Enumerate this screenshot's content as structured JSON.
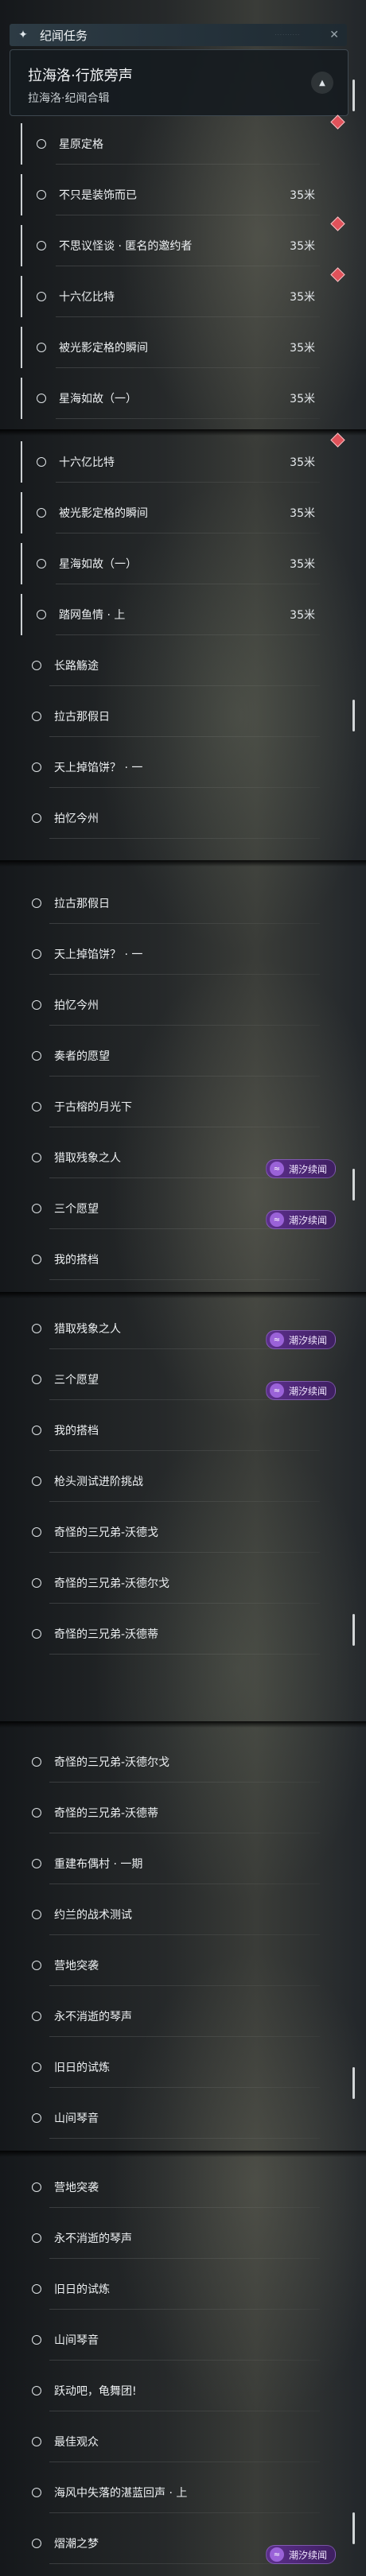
{
  "header": {
    "tab_title": "纪闻任务",
    "mission_title": "拉海洛·行旅旁声",
    "mission_subtitle": "拉海洛·纪闻合辑",
    "tiny_hint": "· · · · · · · · · ·"
  },
  "tag_label": "潮汐续闻",
  "segments": [
    {
      "rows": [
        {
          "label": "星原定格",
          "dist": "",
          "kind": "sub",
          "diamond": true
        },
        {
          "label": "不只是装饰而已",
          "dist": "35米",
          "kind": "sub"
        },
        {
          "label": "不思议怪谈 · 匿名的邀约者",
          "dist": "35米",
          "kind": "sub",
          "diamond": true
        },
        {
          "label": "十六亿比特",
          "dist": "35米",
          "kind": "sub",
          "diamond": true
        },
        {
          "label": "被光影定格的瞬间",
          "dist": "35米",
          "kind": "sub"
        },
        {
          "label": "星海如故（一）",
          "dist": "35米",
          "kind": "sub"
        }
      ]
    },
    {
      "rows": [
        {
          "label": "十六亿比特",
          "dist": "35米",
          "kind": "sub",
          "diamond": true
        },
        {
          "label": "被光影定格的瞬间",
          "dist": "35米",
          "kind": "sub"
        },
        {
          "label": "星海如故（一）",
          "dist": "35米",
          "kind": "sub"
        },
        {
          "label": "踏网鱼情 · 上",
          "dist": "35米",
          "kind": "sub"
        },
        {
          "label": "长路觞途",
          "dist": "",
          "kind": "top"
        },
        {
          "label": "拉古那假日",
          "dist": "",
          "kind": "top"
        },
        {
          "label": "天上掉馅饼？ · 一",
          "dist": "",
          "kind": "top"
        },
        {
          "label": "拍忆今州",
          "dist": "",
          "kind": "top"
        }
      ]
    },
    {
      "rows": [
        {
          "label": "拉古那假日",
          "dist": "",
          "kind": "top"
        },
        {
          "label": "天上掉馅饼？ · 一",
          "dist": "",
          "kind": "top"
        },
        {
          "label": "拍忆今州",
          "dist": "",
          "kind": "top"
        },
        {
          "label": "奏者的愿望",
          "dist": "",
          "kind": "top"
        },
        {
          "label": "于古榕的月光下",
          "dist": "",
          "kind": "top"
        },
        {
          "label": "猎取残象之人",
          "dist": "",
          "kind": "top",
          "tag": true
        },
        {
          "label": "三个愿望",
          "dist": "",
          "kind": "top",
          "tag": true
        },
        {
          "label": "我的搭档",
          "dist": "",
          "kind": "top"
        }
      ]
    },
    {
      "rows": [
        {
          "label": "猎取残象之人",
          "dist": "",
          "kind": "top",
          "tag": true
        },
        {
          "label": "三个愿望",
          "dist": "",
          "kind": "top",
          "tag": true
        },
        {
          "label": "我的搭档",
          "dist": "",
          "kind": "top"
        },
        {
          "label": "枪头测试进阶挑战",
          "dist": "",
          "kind": "top"
        },
        {
          "label": "奇怪的三兄弟-沃德戈",
          "dist": "",
          "kind": "top"
        },
        {
          "label": "奇怪的三兄弟-沃德尔戈",
          "dist": "",
          "kind": "top"
        },
        {
          "label": "奇怪的三兄弟-沃德蒂",
          "dist": "",
          "kind": "top"
        }
      ]
    },
    {
      "rows": [
        {
          "label": "奇怪的三兄弟-沃德尔戈",
          "dist": "",
          "kind": "top"
        },
        {
          "label": "奇怪的三兄弟-沃德蒂",
          "dist": "",
          "kind": "top"
        },
        {
          "label": "重建布偶村 · 一期",
          "dist": "",
          "kind": "top"
        },
        {
          "label": "约兰的战术测试",
          "dist": "",
          "kind": "top"
        },
        {
          "label": "营地突袭",
          "dist": "",
          "kind": "top"
        },
        {
          "label": "永不消逝的琴声",
          "dist": "",
          "kind": "top"
        },
        {
          "label": "旧日的试炼",
          "dist": "",
          "kind": "top"
        },
        {
          "label": "山间琴音",
          "dist": "",
          "kind": "top"
        }
      ]
    },
    {
      "rows": [
        {
          "label": "营地突袭",
          "dist": "",
          "kind": "top"
        },
        {
          "label": "永不消逝的琴声",
          "dist": "",
          "kind": "top"
        },
        {
          "label": "旧日的试炼",
          "dist": "",
          "kind": "top"
        },
        {
          "label": "山间琴音",
          "dist": "",
          "kind": "top"
        },
        {
          "label": "跃动吧，龟舞团!",
          "dist": "",
          "kind": "top"
        },
        {
          "label": "最佳观众",
          "dist": "",
          "kind": "top"
        },
        {
          "label": "海风中失落的湛蓝回声 · 上",
          "dist": "",
          "kind": "top"
        },
        {
          "label": "熠潮之梦",
          "dist": "",
          "kind": "top",
          "tag": true
        }
      ]
    }
  ]
}
